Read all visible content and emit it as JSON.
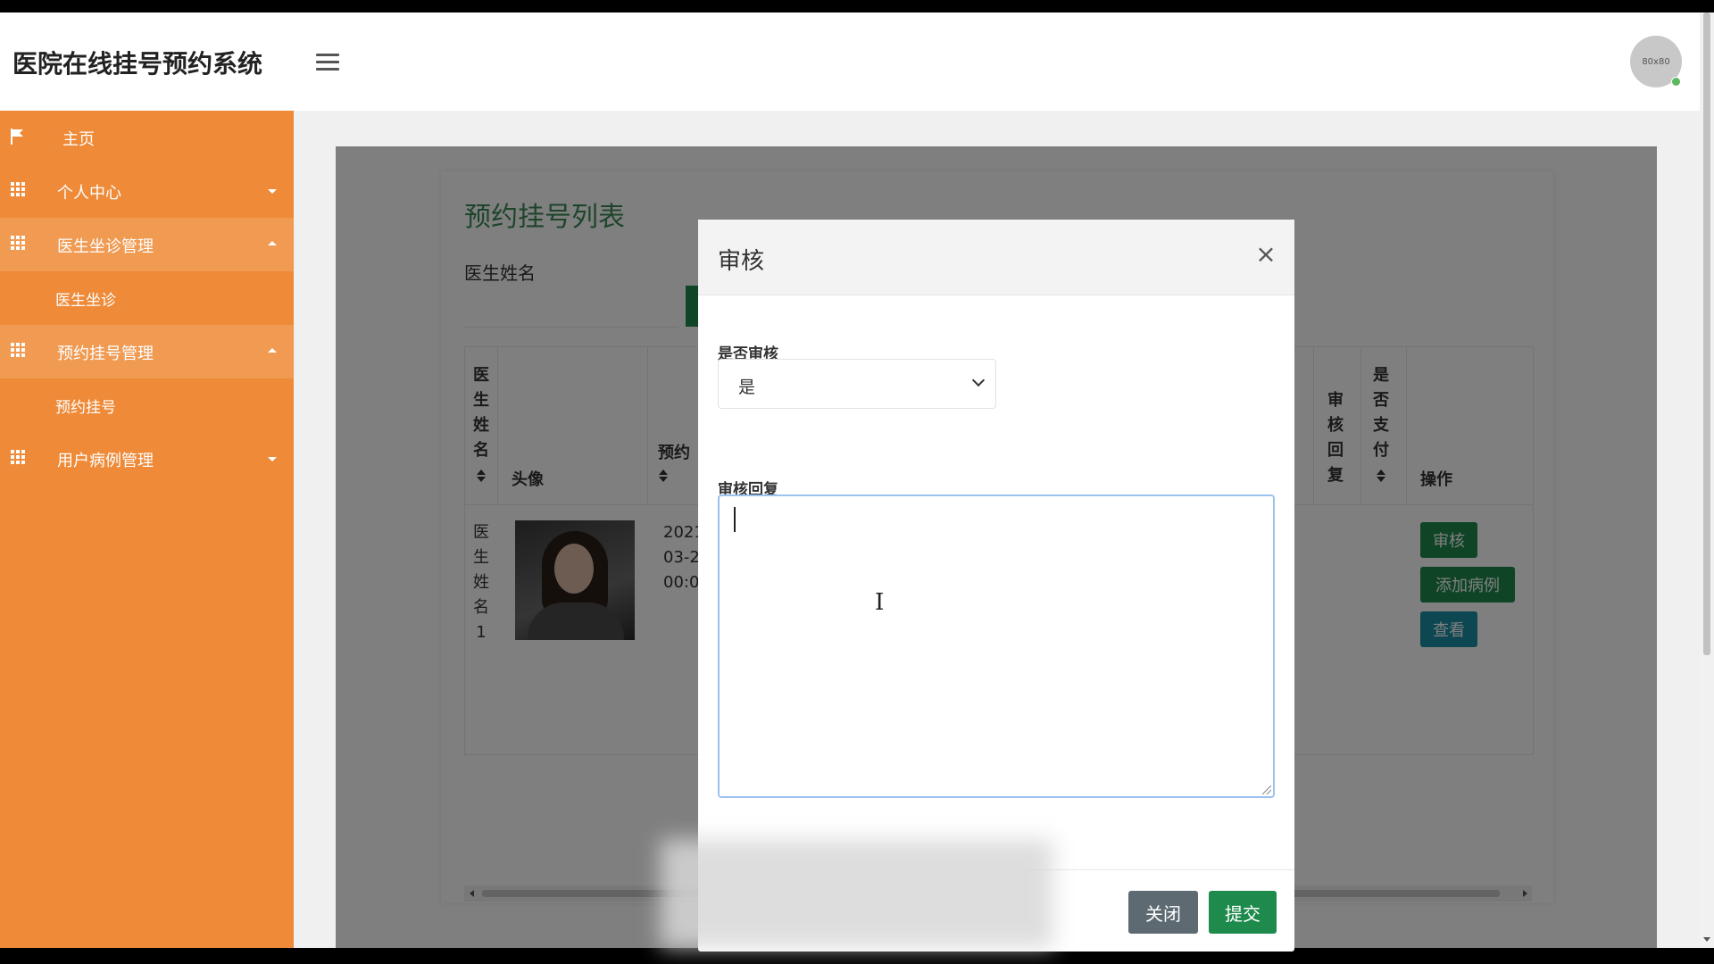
{
  "app": {
    "title": "医院在线挂号预约系统",
    "avatar_text": "80x80"
  },
  "sidebar": {
    "items": [
      {
        "label": "主页"
      },
      {
        "label": "个人中心"
      },
      {
        "label": "医生坐诊管理"
      },
      {
        "label": "医生坐诊"
      },
      {
        "label": "预约挂号管理"
      },
      {
        "label": "预约挂号"
      },
      {
        "label": "用户病例管理"
      }
    ]
  },
  "page": {
    "title": "预约挂号列表",
    "search_label": "医生姓名",
    "table": {
      "headers": [
        "医生姓名",
        "头像",
        "预约",
        "审核回复",
        "是否支付",
        "操作"
      ],
      "row": {
        "doctor_name": "医生姓名1",
        "date_lines": [
          "2021",
          "03-2",
          "00:0"
        ]
      },
      "actions": [
        "审核",
        "添加病例",
        "查看"
      ]
    }
  },
  "modal": {
    "title": "审核",
    "close_symbol": "×",
    "field_review_label": "是否审核",
    "field_review_value": "是",
    "field_reply_label": "审核回复",
    "reply_value": "",
    "btn_close": "关闭",
    "btn_submit": "提交"
  },
  "colors": {
    "sidebar": "#ee8a38",
    "primary_green": "#1e8a4c",
    "teal": "#1a8fa5",
    "title_green": "#3c8a56"
  }
}
